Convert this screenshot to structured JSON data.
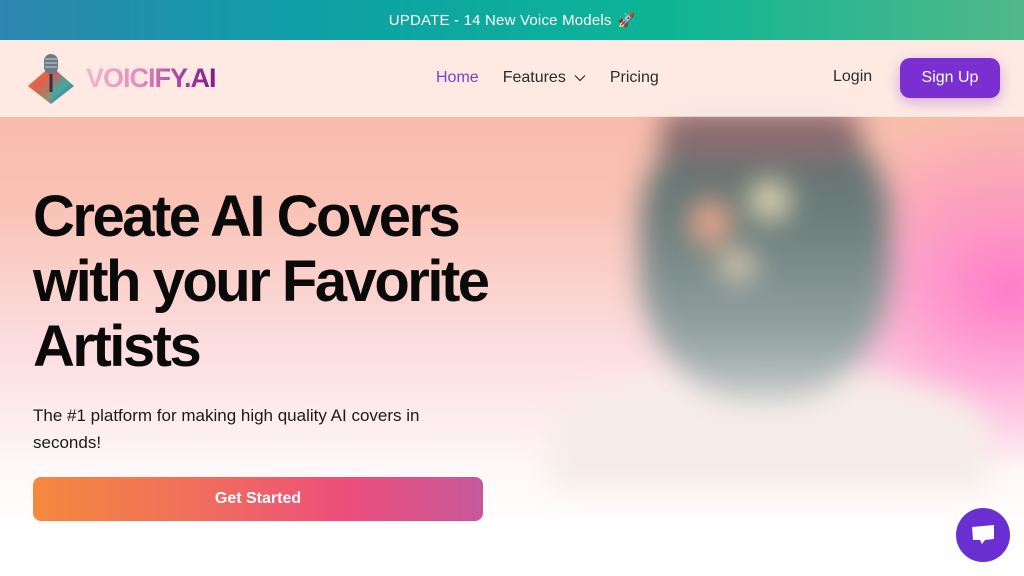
{
  "banner": {
    "text": "UPDATE - 14 New Voice Models",
    "emoji": "🚀"
  },
  "brand": {
    "name": "VOICIFY.AI",
    "accent": "#7a2fd0"
  },
  "nav": {
    "links": [
      {
        "label": "Home",
        "active": true
      },
      {
        "label": "Features",
        "has_dropdown": true
      },
      {
        "label": "Pricing"
      }
    ],
    "login_label": "Login",
    "signup_label": "Sign Up"
  },
  "hero": {
    "headline": "Create AI Covers with your Favorite Artists",
    "subtext": "The #1 platform for making high quality AI covers in seconds!",
    "cta_label": "Get Started"
  },
  "chat": {
    "icon": "chat-bubble-icon"
  }
}
